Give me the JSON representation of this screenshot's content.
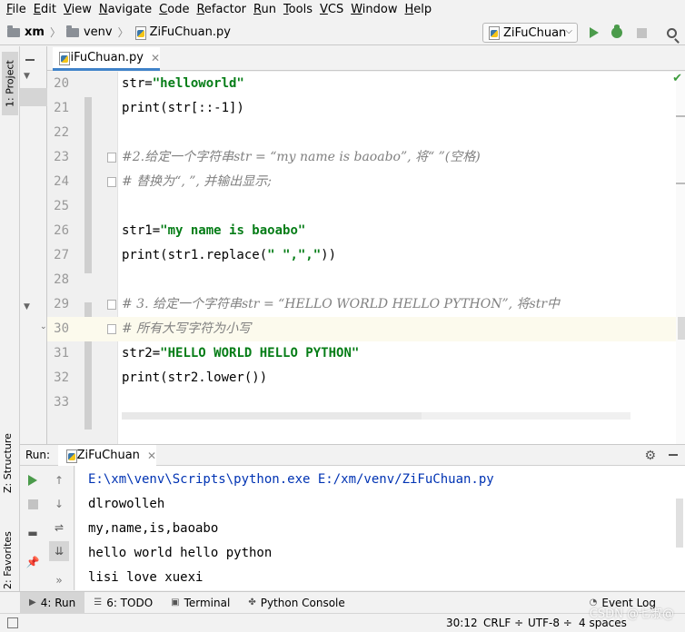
{
  "menu": [
    "File",
    "Edit",
    "View",
    "Navigate",
    "Code",
    "Refactor",
    "Run",
    "Tools",
    "VCS",
    "Window",
    "Help"
  ],
  "breadcrumb": {
    "project": "xm",
    "folder": "venv",
    "file": "ZiFuChuan.py"
  },
  "run_config": {
    "name": "ZiFuChuan"
  },
  "tool_strip": {
    "project": "1: Project",
    "structure": "Z: Structure",
    "favorites": "2: Favorites"
  },
  "editor": {
    "tab": "ZiFuChuan.py",
    "lines": [
      {
        "num": "20",
        "prefix": "str=",
        "string": "\"helloworld\"",
        "rest": ""
      },
      {
        "num": "21",
        "code": "print(str[::-1])"
      },
      {
        "num": "22",
        "code": ""
      },
      {
        "num": "23",
        "comment": "#2.给定一个字符串str = “my name is baoabo”, 将“ ”(空格)"
      },
      {
        "num": "24",
        "comment": "# 替换为“, ”, 并输出显示;"
      },
      {
        "num": "25",
        "code": ""
      },
      {
        "num": "26",
        "prefix": "str1=",
        "string": "\"my name is baoabo\"",
        "rest": ""
      },
      {
        "num": "27",
        "prefix": "print(str1.replace(",
        "string": "\" \",\",\"",
        "rest": "))"
      },
      {
        "num": "28",
        "code": ""
      },
      {
        "num": "29",
        "comment": "# 3. 给定一个字符串str = “HELLO WORLD HELLO PYTHON”, 将str中"
      },
      {
        "num": "30",
        "comment": "# 所有大写字符为小写"
      },
      {
        "num": "31",
        "prefix": "str2=",
        "string": "\"HELLO WORLD HELLO PYTHON\"",
        "rest": ""
      },
      {
        "num": "32",
        "code": "print(str2.lower())"
      },
      {
        "num": "33",
        "code": ""
      }
    ]
  },
  "run_panel": {
    "label": "Run:",
    "tab": "ZiFuChuan",
    "output": [
      "E:\\xm\\venv\\Scripts\\python.exe E:/xm/venv/ZiFuChuan.py",
      "dlrowolleh",
      "my,name,is,baoabo",
      "hello world hello python",
      "lisi love xuexi"
    ]
  },
  "bottom_tabs": {
    "run": "4: Run",
    "todo": "6: TODO",
    "terminal": "Terminal",
    "console": "Python Console",
    "event_log": "Event Log"
  },
  "status": {
    "position": "30:12",
    "line_sep": "CRLF",
    "encoding": "UTF-8",
    "indent": "4 spaces"
  },
  "watermark": "CSDN @七淑@"
}
